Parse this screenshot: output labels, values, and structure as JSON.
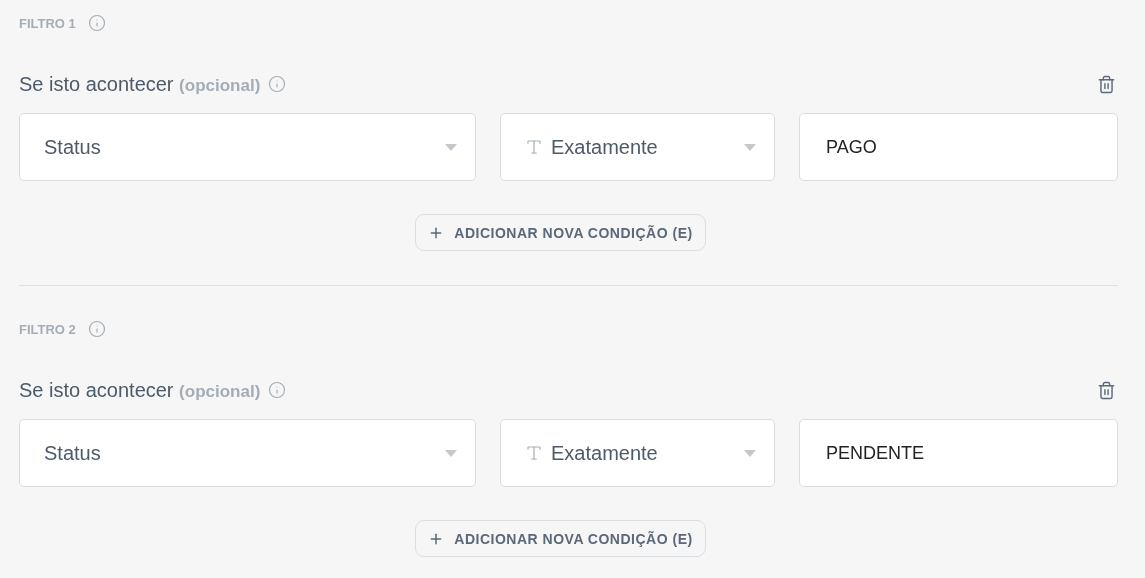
{
  "filters": [
    {
      "label": "FILTRO 1",
      "heading": "Se isto acontecer",
      "heading_note": "(opcional)",
      "field": "Status",
      "operator": "Exatamente",
      "value": "PAGO",
      "add_button": "ADICIONAR NOVA CONDIÇÃO (E)"
    },
    {
      "label": "FILTRO 2",
      "heading": "Se isto acontecer",
      "heading_note": "(opcional)",
      "field": "Status",
      "operator": "Exatamente",
      "value": "PENDENTE",
      "add_button": "ADICIONAR NOVA CONDIÇÃO (E)"
    }
  ]
}
